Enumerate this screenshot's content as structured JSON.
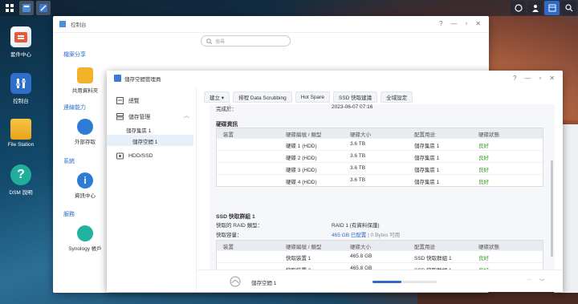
{
  "desktop": {
    "icons": [
      {
        "label": "套件中心"
      },
      {
        "label": "控制台"
      },
      {
        "label": "File Station"
      },
      {
        "label": "DSM 說明"
      }
    ]
  },
  "control_panel": {
    "title": "控制台",
    "search_placeholder": "搜尋",
    "sections": [
      "檔案分享",
      "連線能力",
      "系統",
      "服務"
    ],
    "items": [
      "共用資料夾",
      "外部存取",
      "資訊中心",
      "Synology 帳戶"
    ],
    "window_controls": [
      "?",
      "—",
      "▫",
      "✕"
    ]
  },
  "storage_manager": {
    "title": "儲存空間管理員",
    "nav": {
      "overview": "總覽",
      "storage": "儲存管理",
      "pool": "儲存集區 1",
      "volume": "儲存空間 1",
      "hdd": "HDD/SSD"
    },
    "toolbar": [
      "建立 ▾",
      "排程 Data Scrubbing",
      "Hot Spare",
      "SSD 快取建議",
      "全域設定"
    ],
    "completed_label": "完成於：",
    "completed_value": "2023-06-07 07:16",
    "disk_section": "硬碟資訊",
    "disk_headers": [
      "裝置",
      "硬碟編號 / 類型",
      "硬碟大小",
      "配置用途",
      "硬碟狀態"
    ],
    "disks": [
      [
        "硬碟 1 (HDD)",
        "3.6 TB",
        "儲存集區 1",
        "良好"
      ],
      [
        "硬碟 2 (HDD)",
        "3.6 TB",
        "儲存集區 1",
        "良好"
      ],
      [
        "硬碟 3 (HDD)",
        "3.6 TB",
        "儲存集區 1",
        "良好"
      ],
      [
        "硬碟 4 (HDD)",
        "3.6 TB",
        "儲存集區 1",
        "良好"
      ]
    ],
    "cache_section": "SSD 快取群組 1",
    "raid_label": "快取的 RAID 類型：",
    "raid_value": "RAID 1 (有資料保護)",
    "capacity_label": "快取容量：",
    "capacity_alloc": "465 GB 已配置",
    "capacity_avail": " | 0 Bytes 可用",
    "cache_headers": [
      "裝置",
      "硬碟編號 / 類型",
      "硬碟大小",
      "配置用途",
      "硬碟狀態"
    ],
    "cache_devices": [
      [
        "快取裝置 1",
        "465.8 GB",
        "SSD 快取群組 1",
        "良好"
      ],
      [
        "快取裝置 2",
        "465.8 GB",
        "SSD 快取群組 1",
        "良好"
      ]
    ],
    "bottom_label": "儲存空間 1",
    "bottom_progress": 0.45,
    "bottom_more": "···"
  }
}
